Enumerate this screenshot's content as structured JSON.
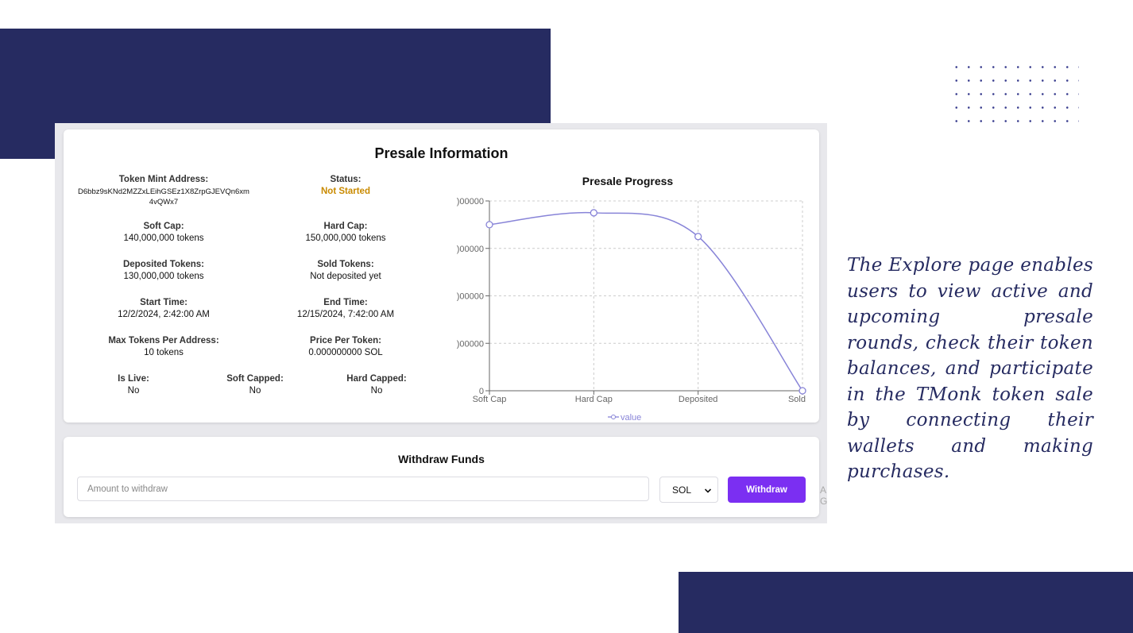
{
  "presale": {
    "title": "Presale Information",
    "token_mint": {
      "label": "Token Mint Address:",
      "value": "D6bbz9sKNd2MZZxLEihGSEz1X8ZrpGJEVQn6xm4vQWx7"
    },
    "status": {
      "label": "Status:",
      "value": "Not Started"
    },
    "soft_cap": {
      "label": "Soft Cap:",
      "value": "140,000,000 tokens"
    },
    "hard_cap": {
      "label": "Hard Cap:",
      "value": "150,000,000 tokens"
    },
    "deposited": {
      "label": "Deposited Tokens:",
      "value": "130,000,000 tokens"
    },
    "sold": {
      "label": "Sold Tokens:",
      "value": "Not deposited yet"
    },
    "start_time": {
      "label": "Start Time:",
      "value": "12/2/2024, 2:42:00 AM"
    },
    "end_time": {
      "label": "End Time:",
      "value": "12/15/2024, 7:42:00 AM"
    },
    "max_tokens": {
      "label": "Max Tokens Per Address:",
      "value": "10 tokens"
    },
    "price": {
      "label": "Price Per Token:",
      "value": "0.000000000 SOL"
    },
    "is_live": {
      "label": "Is Live:",
      "value": "No"
    },
    "soft_capped": {
      "label": "Soft Capped:",
      "value": "No"
    },
    "hard_capped": {
      "label": "Hard Capped:",
      "value": "No"
    }
  },
  "chart_data": {
    "type": "line",
    "title": "Presale Progress",
    "categories": [
      "Soft Cap",
      "Hard Cap",
      "Deposited",
      "Sold"
    ],
    "series": [
      {
        "name": "value",
        "values": [
          140000000,
          150000000,
          130000000,
          0
        ]
      }
    ],
    "y_ticks": [
      "0",
      ")00000",
      ")00000",
      ")00000",
      ")00000"
    ],
    "ylim": [
      0,
      160000000
    ],
    "grid": true,
    "legend": "bottom",
    "color": "#8884d8"
  },
  "withdraw": {
    "title": "Withdraw Funds",
    "amount_placeholder": "Amount to withdraw",
    "currency": "SOL",
    "button_label": "Withdraw"
  },
  "cutoff_text": "A G",
  "caption": "The Explore page enables users to view active and upcoming presale rounds, check their token balances, and participate in the TMonk token sale by connecting their wallets and making purchases.",
  "colors": {
    "navy": "#262b61",
    "accent": "#7b2ff2",
    "status": "#c98a00"
  }
}
